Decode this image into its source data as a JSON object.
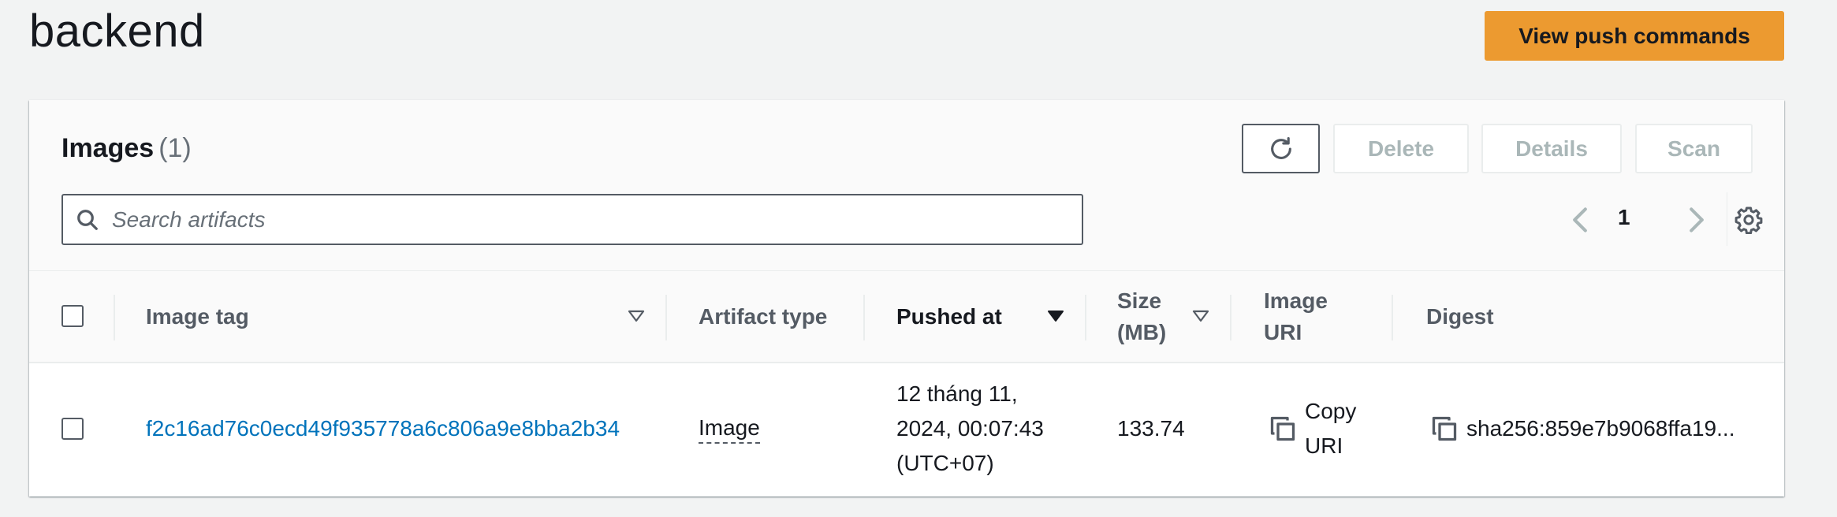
{
  "page": {
    "title": "backend",
    "primary_action": "View push commands"
  },
  "images_panel": {
    "title": "Images",
    "count": "(1)",
    "actions": {
      "delete": "Delete",
      "details": "Details",
      "scan": "Scan"
    },
    "search": {
      "placeholder": "Search artifacts",
      "value": ""
    },
    "pagination": {
      "current_page": "1"
    },
    "columns": {
      "image_tag": "Image tag",
      "artifact_type": "Artifact type",
      "pushed_at": "Pushed at",
      "size_line1": "Size",
      "size_line2": "(MB)",
      "image_uri_line1": "Image",
      "image_uri_line2": "URI",
      "digest": "Digest"
    },
    "rows": [
      {
        "image_tag": "f2c16ad76c0ecd49f935778a6c806a9e8bba2b34",
        "artifact_type": "Image",
        "pushed_at_line1": "12 tháng 11,",
        "pushed_at_line2": "2024, 00:07:43",
        "pushed_at_line3": "(UTC+07)",
        "size_mb": "133.74",
        "copy_uri_line1": "Copy",
        "copy_uri_line2": "URI",
        "digest": "sha256:859e7b9068ffa19..."
      }
    ]
  },
  "colors": {
    "primary_button": "#ec9a30",
    "link": "#0073bb",
    "background": "#f2f3f3"
  }
}
